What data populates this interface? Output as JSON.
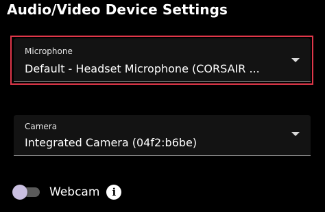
{
  "page": {
    "title": "Audio/Video Device Settings"
  },
  "microphone": {
    "label": "Microphone",
    "value": "Default - Headset Microphone (CORSAIR ...",
    "highlight_color": "#e0374a"
  },
  "camera": {
    "label": "Camera",
    "value": "Integrated Camera (04f2:b6be)"
  },
  "webcam": {
    "label": "Webcam",
    "enabled": false,
    "info_icon": "info-icon",
    "info_glyph": "i"
  },
  "colors": {
    "background": "#000000",
    "field_background": "#131313",
    "toggle_thumb": "#c9bfe0",
    "toggle_track": "#5a5a5a"
  }
}
